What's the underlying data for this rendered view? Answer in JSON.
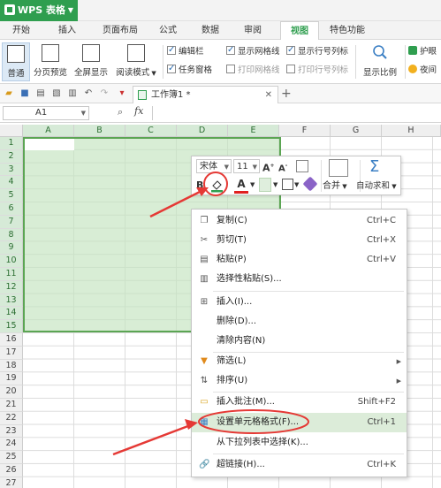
{
  "app": {
    "title": "WPS 表格"
  },
  "menu_tabs": [
    "开始",
    "插入",
    "页面布局",
    "公式",
    "数据",
    "审阅",
    "视图",
    "特色功能"
  ],
  "active_tab": "视图",
  "ribbon": {
    "views": [
      "普通",
      "分页预览",
      "全屏显示",
      "阅读模式"
    ],
    "checks": [
      {
        "label": "编辑栏",
        "checked": true
      },
      {
        "label": "任务窗格",
        "checked": true
      },
      {
        "label": "显示网格线",
        "checked": true
      },
      {
        "label": "打印网格线",
        "checked": false
      },
      {
        "label": "显示行号列标",
        "checked": true
      },
      {
        "label": "打印行号列标",
        "checked": false
      }
    ],
    "zoom": "显示比例",
    "protect": "护眼",
    "night": "夜间"
  },
  "document_tab": "工作簿1 *",
  "formula_bar": {
    "cell_ref": "A1",
    "fx": "fx"
  },
  "columns": [
    "A",
    "B",
    "C",
    "D",
    "E",
    "F",
    "G",
    "H"
  ],
  "rows": [
    "1",
    "2",
    "3",
    "4",
    "5",
    "6",
    "7",
    "8",
    "9",
    "10",
    "11",
    "12",
    "13",
    "14",
    "15",
    "16",
    "17",
    "18",
    "19",
    "20",
    "21",
    "22",
    "23",
    "24",
    "25",
    "26",
    "27"
  ],
  "mini_toolbar": {
    "font": "宋体",
    "size": "11",
    "bold": "B",
    "font_color": "A",
    "merge": "合并",
    "autosum": "自动求和"
  },
  "context_menu": [
    {
      "label": "复制(C)",
      "shortcut": "Ctrl+C",
      "icon": "copy-icon"
    },
    {
      "label": "剪切(T)",
      "shortcut": "Ctrl+X",
      "icon": "scissors-icon"
    },
    {
      "label": "粘贴(P)",
      "shortcut": "Ctrl+V",
      "icon": "paste-icon"
    },
    {
      "label": "选择性粘贴(S)...",
      "shortcut": "",
      "icon": "paste-special-icon"
    },
    {
      "label": "插入(I)...",
      "shortcut": "",
      "icon": "insert-icon"
    },
    {
      "label": "删除(D)...",
      "shortcut": "",
      "icon": ""
    },
    {
      "label": "清除内容(N)",
      "shortcut": "",
      "icon": ""
    },
    {
      "label": "筛选(L)",
      "shortcut": "",
      "icon": "filter-icon",
      "submenu": true
    },
    {
      "label": "排序(U)",
      "shortcut": "",
      "icon": "sort-icon",
      "submenu": true
    },
    {
      "label": "插入批注(M)...",
      "shortcut": "Shift+F2",
      "icon": "comment-icon"
    },
    {
      "label": "设置单元格格式(F)...",
      "shortcut": "Ctrl+1",
      "icon": "format-cells-icon"
    },
    {
      "label": "从下拉列表中选择(K)...",
      "shortcut": "",
      "icon": ""
    },
    {
      "label": "超链接(H)...",
      "shortcut": "Ctrl+K",
      "icon": "hyperlink-icon"
    }
  ],
  "colors": {
    "brand": "#2f9e4f",
    "selection": "#c3e4be",
    "highlight": "#dcecd9",
    "annotation": "#e53935"
  }
}
